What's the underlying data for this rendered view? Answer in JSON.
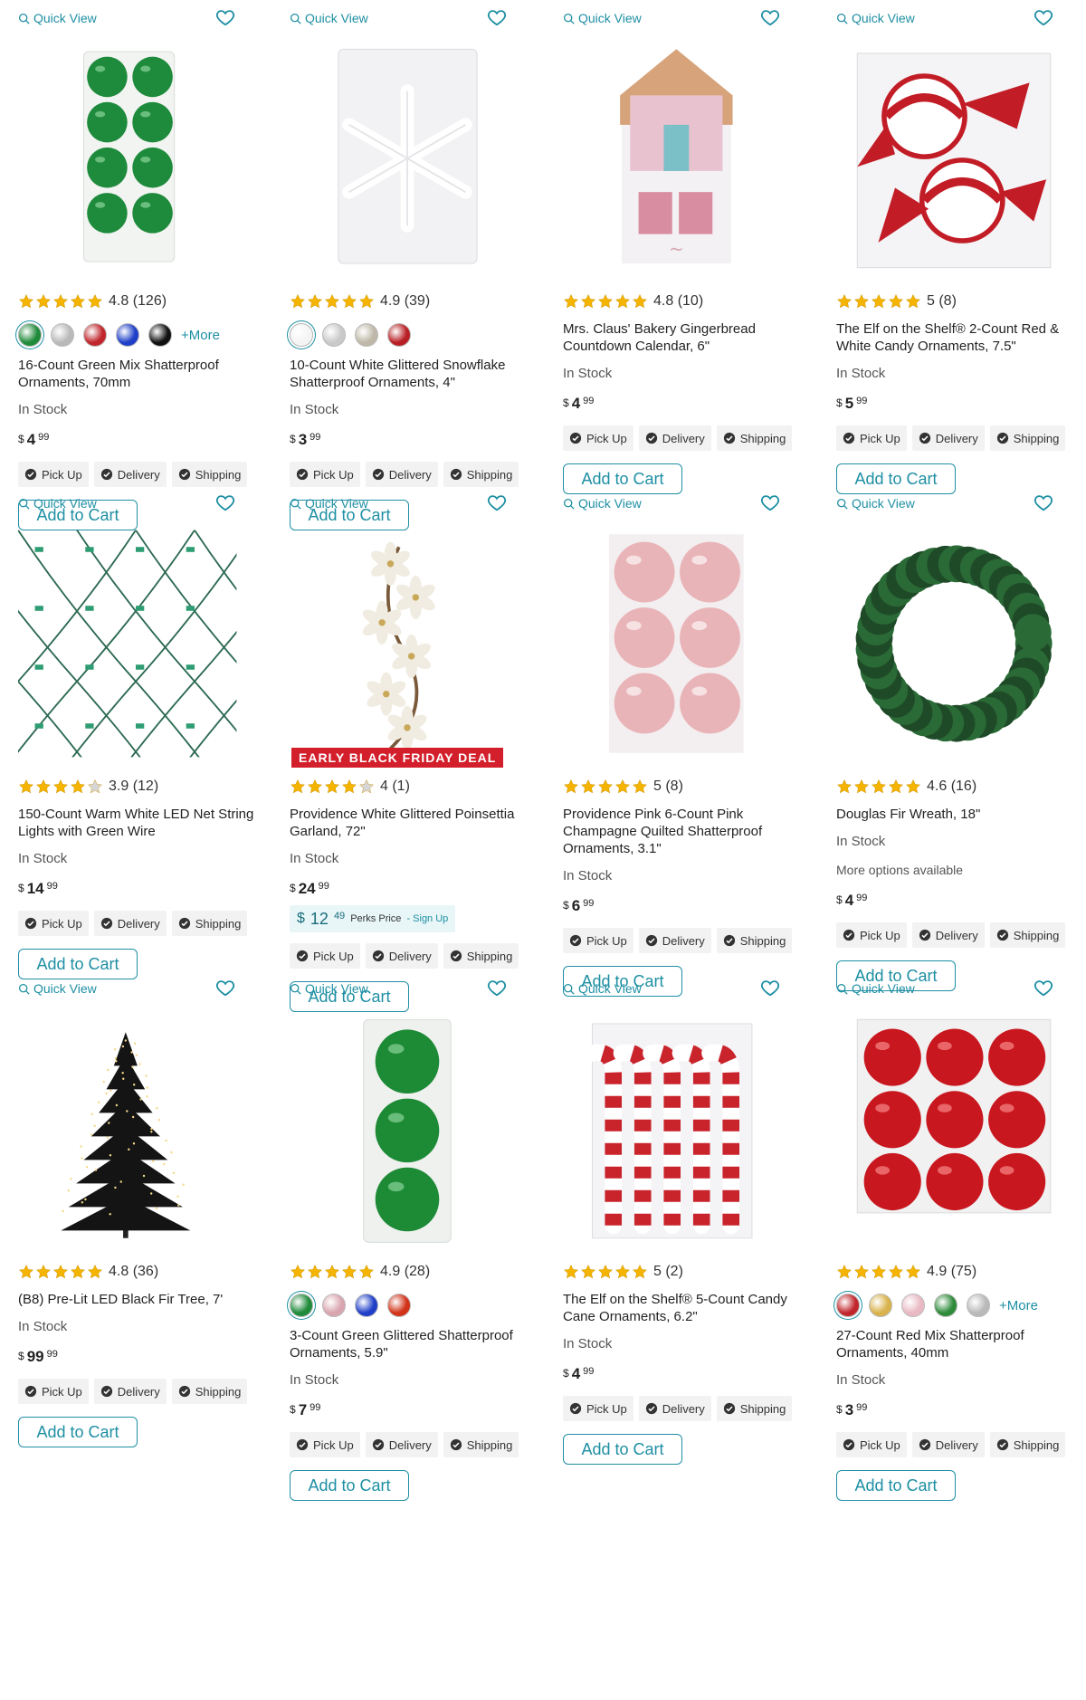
{
  "common": {
    "quick_view": "Quick View",
    "add_to_cart": "Add to Cart",
    "pickup": "Pick Up",
    "delivery": "Delivery",
    "shipping": "Shipping",
    "in_stock": "In Stock",
    "more": "+More",
    "currency": "$"
  },
  "products": [
    {
      "name": "16-Count Green Mix Shatterproof Ornaments, 70mm",
      "rating": "4.8 (126)",
      "stars": 5,
      "swatches": [
        "#1f8a3a",
        "#b9b9b9",
        "#c0262c",
        "#1f3fc8",
        "#111111"
      ],
      "show_more": true,
      "price_dollars": "4",
      "price_cents": "99",
      "image": "green-ornaments"
    },
    {
      "name": "10-Count White Glittered Snowflake Shatterproof Ornaments, 4\"",
      "rating": "4.9 (39)",
      "stars": 5,
      "swatches": [
        "#f4f4f4",
        "#c9c9c9",
        "#bfb8a8",
        "#b81f24"
      ],
      "show_more": false,
      "price_dollars": "3",
      "price_cents": "99",
      "image": "snowflake"
    },
    {
      "name": "Mrs. Claus' Bakery Gingerbread Countdown Calendar, 6\"",
      "rating": "4.8 (10)",
      "stars": 5,
      "swatches": [],
      "show_more": false,
      "price_dollars": "4",
      "price_cents": "99",
      "image": "gingerbread"
    },
    {
      "name": "The Elf on the Shelf® 2-Count Red & White Candy Ornaments, 7.5\"",
      "rating": "5 (8)",
      "stars": 5,
      "swatches": [],
      "show_more": false,
      "price_dollars": "5",
      "price_cents": "99",
      "image": "candy"
    },
    {
      "name": "150-Count Warm White LED Net String Lights with Green Wire",
      "rating": "3.9 (12)",
      "stars": 4,
      "swatches": [],
      "show_more": false,
      "price_dollars": "14",
      "price_cents": "99",
      "image": "net-lights"
    },
    {
      "name": "Providence White Glittered Poinsettia Garland, 72\"",
      "rating": "4 (1)",
      "stars": 4,
      "deal": "EARLY BLACK FRIDAY DEAL",
      "swatches": [],
      "show_more": false,
      "price_dollars": "24",
      "price_cents": "99",
      "perks": {
        "dollars": "12",
        "cents": "49",
        "label": "Perks Price",
        "sign": "- Sign Up"
      },
      "image": "poinsettia"
    },
    {
      "name": "Providence Pink 6-Count Pink Champagne Quilted Shatterproof Ornaments, 3.1\"",
      "rating": "5 (8)",
      "stars": 5,
      "swatches": [],
      "show_more": false,
      "price_dollars": "6",
      "price_cents": "99",
      "image": "pink-ornaments"
    },
    {
      "name": "Douglas Fir Wreath, 18\"",
      "rating": "4.6 (16)",
      "stars": 5,
      "swatches": [],
      "show_more": false,
      "more_options": "More options available",
      "price_dollars": "4",
      "price_cents": "99",
      "image": "wreath"
    },
    {
      "name": "(B8) Pre-Lit LED Black Fir Tree, 7'",
      "rating": "4.8 (36)",
      "stars": 5,
      "swatches": [],
      "show_more": false,
      "price_dollars": "99",
      "price_cents": "99",
      "image": "black-tree"
    },
    {
      "name": "3-Count Green Glittered Shatterproof Ornaments, 5.9\"",
      "rating": "4.9 (28)",
      "stars": 5,
      "swatches": [
        "#1f8a3a",
        "#d9a5ae",
        "#1f3fc8",
        "#d13218"
      ],
      "show_more": false,
      "price_dollars": "7",
      "price_cents": "99",
      "image": "green-3"
    },
    {
      "name": "The Elf on the Shelf® 5-Count Candy Cane Ornaments, 6.2\"",
      "rating": "5 (2)",
      "stars": 5,
      "swatches": [],
      "show_more": false,
      "price_dollars": "4",
      "price_cents": "99",
      "image": "candy-canes"
    },
    {
      "name": "27-Count Red Mix Shatterproof Ornaments, 40mm",
      "rating": "4.9 (75)",
      "stars": 5,
      "swatches": [
        "#c0262c",
        "#d8b24a",
        "#e9b9c3",
        "#2e8b3a",
        "#b9b9b9"
      ],
      "show_more": true,
      "price_dollars": "3",
      "price_cents": "99",
      "image": "red-ornaments"
    }
  ]
}
